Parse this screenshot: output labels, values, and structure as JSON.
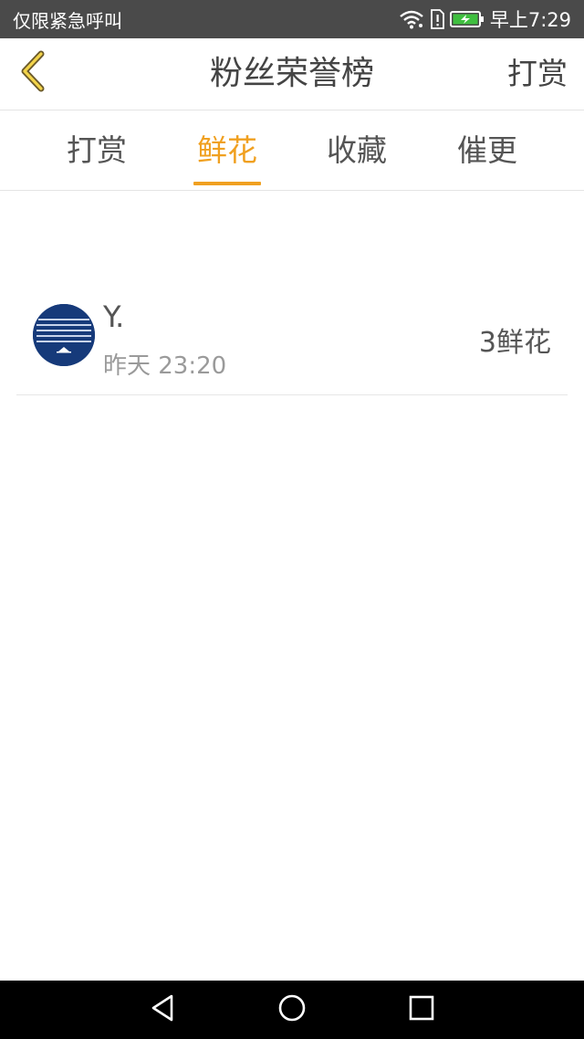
{
  "status_bar": {
    "left_text": "仅限紧急呼叫",
    "time": "早上7:29",
    "icons": [
      "wifi-icon",
      "sim-alert-icon",
      "battery-charging-icon"
    ]
  },
  "header": {
    "title": "粉丝荣誉榜",
    "back_icon": "chevron-left-icon",
    "right_action": "打赏"
  },
  "tabs": [
    {
      "label": "打赏",
      "active": false
    },
    {
      "label": "鲜花",
      "active": true
    },
    {
      "label": "收藏",
      "active": false
    },
    {
      "label": "催更",
      "active": false
    }
  ],
  "list": {
    "items": [
      {
        "name": "Y.",
        "time": "昨天 23:20",
        "count": "3鲜花"
      }
    ]
  },
  "nav_bar": {
    "icons": [
      "back-triangle-icon",
      "home-circle-icon",
      "recent-square-icon"
    ]
  },
  "colors": {
    "accent": "#f0a020",
    "status_bar": "#4a4a4a",
    "nav_bar": "#000000",
    "text": "#444444",
    "subtext": "#9a9a9a"
  }
}
